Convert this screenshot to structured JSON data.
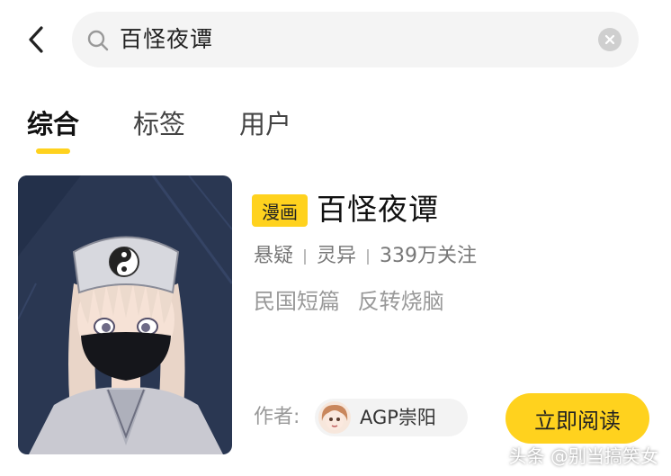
{
  "search": {
    "query": "百怪夜谭"
  },
  "tabs": [
    {
      "label": "综合",
      "active": true
    },
    {
      "label": "标签",
      "active": false
    },
    {
      "label": "用户",
      "active": false
    }
  ],
  "result": {
    "badge": "漫画",
    "title": "百怪夜谭",
    "genres": [
      "悬疑",
      "灵异"
    ],
    "followers": "339万关注",
    "tags": [
      "民国短篇",
      "反转烧脑"
    ],
    "author_label": "作者:",
    "author_name": "AGP崇阳",
    "read_button": "立即阅读"
  },
  "watermark": "头条 @别当搞笑女",
  "colors": {
    "accent": "#ffd21e",
    "background": "#ffffff",
    "search_bg": "#f4f4f4"
  },
  "icons": [
    "back-arrow-icon",
    "search-icon",
    "clear-icon"
  ]
}
